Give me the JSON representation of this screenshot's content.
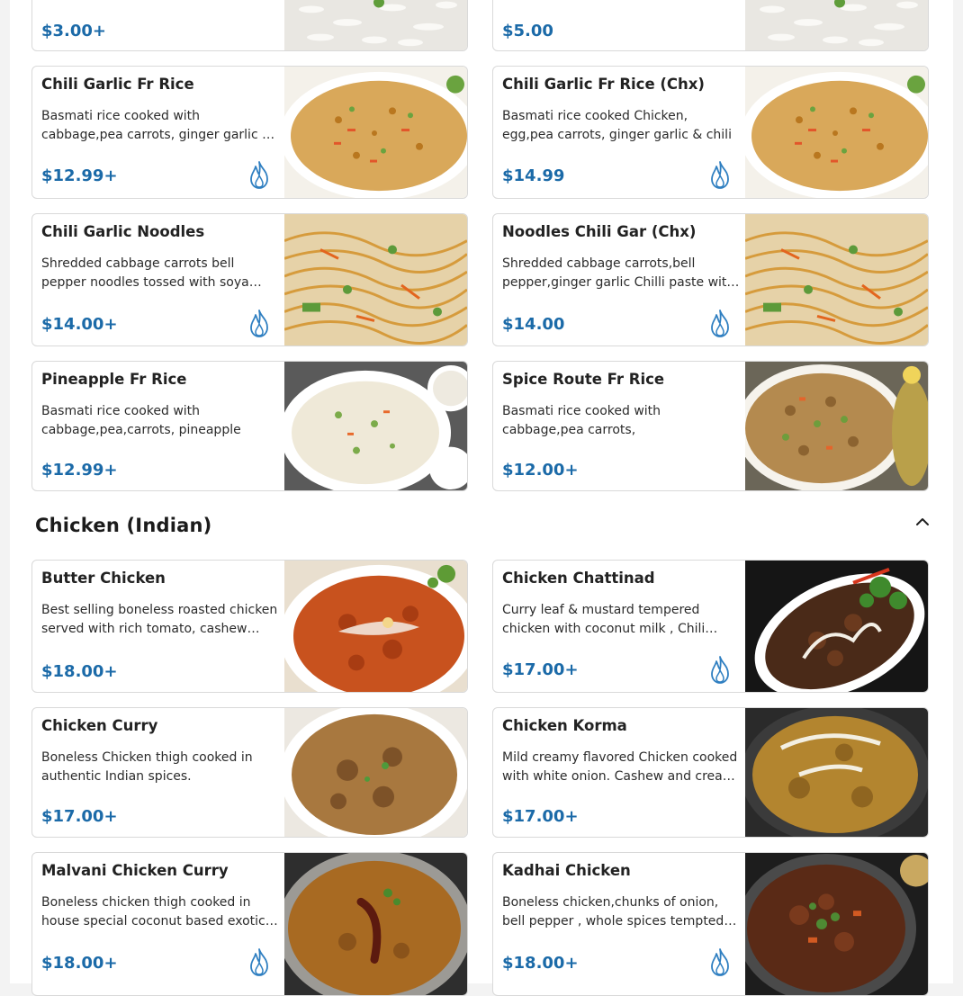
{
  "colors": {
    "price": "#1b6aa8",
    "spice_icon": "#2f7fc1",
    "card_border": "#d9d9d9"
  },
  "cards_top": [
    {
      "price": "$3.00+",
      "image": "white rice"
    },
    {
      "price": "$5.00",
      "image": "white rice"
    }
  ],
  "rice_noodles": [
    {
      "name": "Chili Garlic Fr Rice",
      "desc": "Basmati rice cooked with cabbage,pea carrots, ginger garlic & chili",
      "price": "$12.99+",
      "spicy": true,
      "image": "fried rice"
    },
    {
      "name": "Chili Garlic Fr Rice (Chx)",
      "desc": "Basmati rice cooked Chicken, egg,pea carrots, ginger garlic & chili",
      "price": "$14.99",
      "spicy": true,
      "image": "fried rice"
    },
    {
      "name": "Chili Garlic Noodles",
      "desc": "Shredded cabbage carrots bell pepper noodles tossed with soya sauce",
      "price": "$14.00+",
      "spicy": true,
      "image": "noodles"
    },
    {
      "name": "Noodles Chili Gar (Chx)",
      "desc": "Shredded cabbage carrots,bell pepper,ginger garlic Chilli paste with chicken",
      "price": "$14.00",
      "spicy": true,
      "image": "noodles"
    },
    {
      "name": "Pineapple Fr Rice",
      "desc": "Basmati rice cooked with cabbage,pea,carrots, pineapple",
      "price": "$12.99+",
      "spicy": false,
      "image": "pineapple rice"
    },
    {
      "name": "Spice Route Fr Rice",
      "desc": "Basmati rice cooked with cabbage,pea carrots,",
      "price": "$12.00+",
      "spicy": false,
      "image": "spice rice"
    }
  ],
  "section": {
    "title": "Chicken (Indian)",
    "collapse_icon": "chevron-up-icon"
  },
  "chicken": [
    {
      "name": "Butter Chicken",
      "desc": "Best selling boneless roasted chicken served with rich tomato, cashew gravy",
      "price": "$18.00+",
      "spicy": false,
      "image": "butter chicken"
    },
    {
      "name": "Chicken Chattinad",
      "desc": "Curry leaf & mustard tempered chicken with coconut milk , Chili paste",
      "price": "$17.00+",
      "spicy": true,
      "image": "chattinad"
    },
    {
      "name": "Chicken Curry",
      "desc": "Boneless Chicken thigh cooked in authentic Indian spices.",
      "price": "$17.00+",
      "spicy": false,
      "image": "chicken curry"
    },
    {
      "name": "Chicken Korma",
      "desc": "Mild creamy flavored Chicken cooked with white onion. Cashew and cream sauce",
      "price": "$17.00+",
      "spicy": false,
      "image": "korma"
    },
    {
      "name": "Malvani Chicken Curry",
      "desc": "Boneless chicken thigh cooked in house special coconut based exotic gravy",
      "price": "$18.00+",
      "spicy": true,
      "image": "malvani curry"
    },
    {
      "name": "Kadhai Chicken",
      "desc": "Boneless chicken,chunks of onion, bell pepper , whole spices tempted gravy",
      "price": "$18.00+",
      "spicy": true,
      "image": "kadhai"
    }
  ]
}
